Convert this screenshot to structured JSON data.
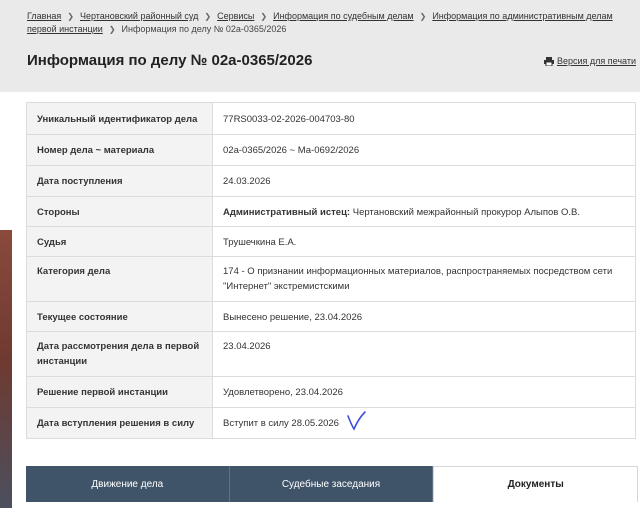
{
  "breadcrumb": {
    "items": [
      "Главная",
      "Чертановский районный суд",
      "Сервисы",
      "Информация по судебным делам",
      "Информация по административным делам первой инстанции"
    ],
    "current": "Информация по делу № 02а-0365/2026"
  },
  "header": {
    "title": "Информация по делу № 02а-0365/2026",
    "print_label": "Версия для печати"
  },
  "case_info": {
    "rows": [
      {
        "label": "Уникальный идентификатор дела",
        "value": "77RS0033-02-2026-004703-80"
      },
      {
        "label": "Номер дела ~ материала",
        "value": "02а-0365/2026 ~ Ма-0692/2026"
      },
      {
        "label": "Дата поступления",
        "value": "24.03.2026"
      },
      {
        "label": "Стороны",
        "value_bold": "Административный истец:",
        "value": "Чертановский межрайонный прокурор Алыпов О.В."
      },
      {
        "label": "Судья",
        "value": "Трушечкина Е.А."
      },
      {
        "label": "Категория дела",
        "value": "174 - О признании информационных материалов, распространяемых посредством сети \"Интернет\" экстремистскими"
      },
      {
        "label": "Текущее состояние",
        "value": "Вынесено решение, 23.04.2026"
      },
      {
        "label": "Дата рассмотрения дела в первой инстанции",
        "value": "23.04.2026"
      },
      {
        "label": "Решение первой инстанции",
        "value": "Удовлетворено, 23.04.2026"
      },
      {
        "label": "Дата вступления решения в силу",
        "value": "Вступит в силу 28.05.2026"
      }
    ]
  },
  "tabs": [
    {
      "label": "Движение дела"
    },
    {
      "label": "Судебные заседания"
    },
    {
      "label": "Документы"
    }
  ],
  "colors": {
    "tab_dark": "#3f5468",
    "header_bg": "#eaeaea",
    "label_bg": "#f3f3f3",
    "check_mark": "#3b4fe0"
  },
  "icons": {
    "print": "printer-icon",
    "separator": "chevron-right-icon",
    "annotation": "handwritten-check-mark"
  }
}
